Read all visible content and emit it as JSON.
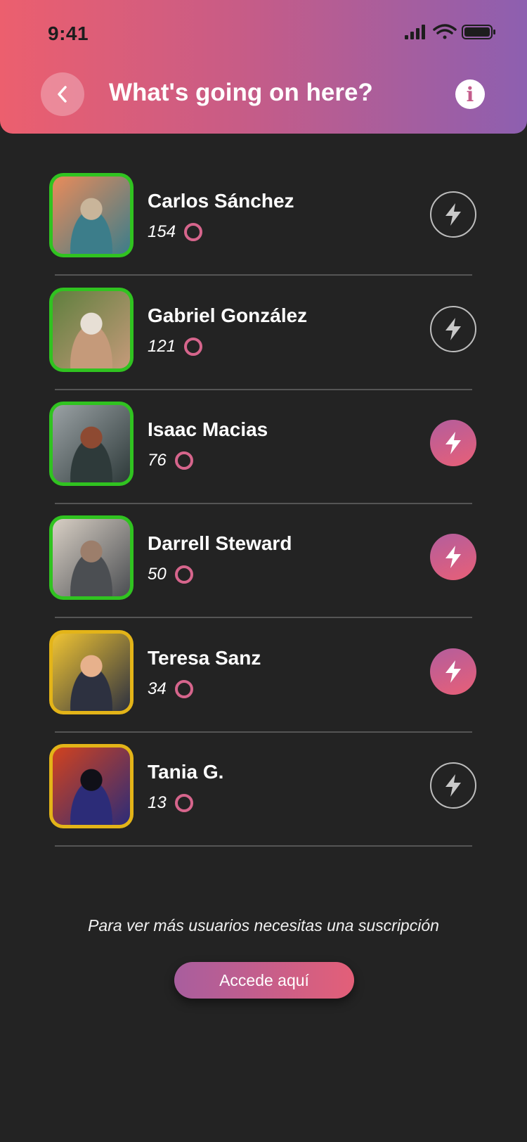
{
  "status_bar": {
    "time": "9:41"
  },
  "header": {
    "title": "What's going on here?"
  },
  "users": [
    {
      "name": "Carlos Sánchez",
      "score": "154",
      "frame": "green",
      "boosted": false,
      "photo_colors": [
        "#e98b5a",
        "#3c7d8a",
        "#c9b59a"
      ]
    },
    {
      "name": "Gabriel González",
      "score": "121",
      "frame": "green",
      "boosted": false,
      "photo_colors": [
        "#5f7f3e",
        "#c59a7a",
        "#e7dfd5"
      ]
    },
    {
      "name": "Isaac Macias",
      "score": "76",
      "frame": "green",
      "boosted": true,
      "photo_colors": [
        "#9aa1a4",
        "#2e3a3a",
        "#8e4a32"
      ]
    },
    {
      "name": "Darrell Steward",
      "score": "50",
      "frame": "green",
      "boosted": true,
      "photo_colors": [
        "#d8cfc4",
        "#4b4e52",
        "#9c7e6b"
      ]
    },
    {
      "name": "Teresa Sanz",
      "score": "34",
      "frame": "gold",
      "boosted": true,
      "photo_colors": [
        "#f0c432",
        "#2d3140",
        "#e7b18c"
      ]
    },
    {
      "name": "Tania G.",
      "score": "13",
      "frame": "gold",
      "boosted": false,
      "photo_colors": [
        "#d2421e",
        "#2c2c78",
        "#101018"
      ]
    }
  ],
  "footer": {
    "subscription_text": "Para ver más usuarios necesitas una suscripción",
    "cta_label": "Accede aquí"
  }
}
